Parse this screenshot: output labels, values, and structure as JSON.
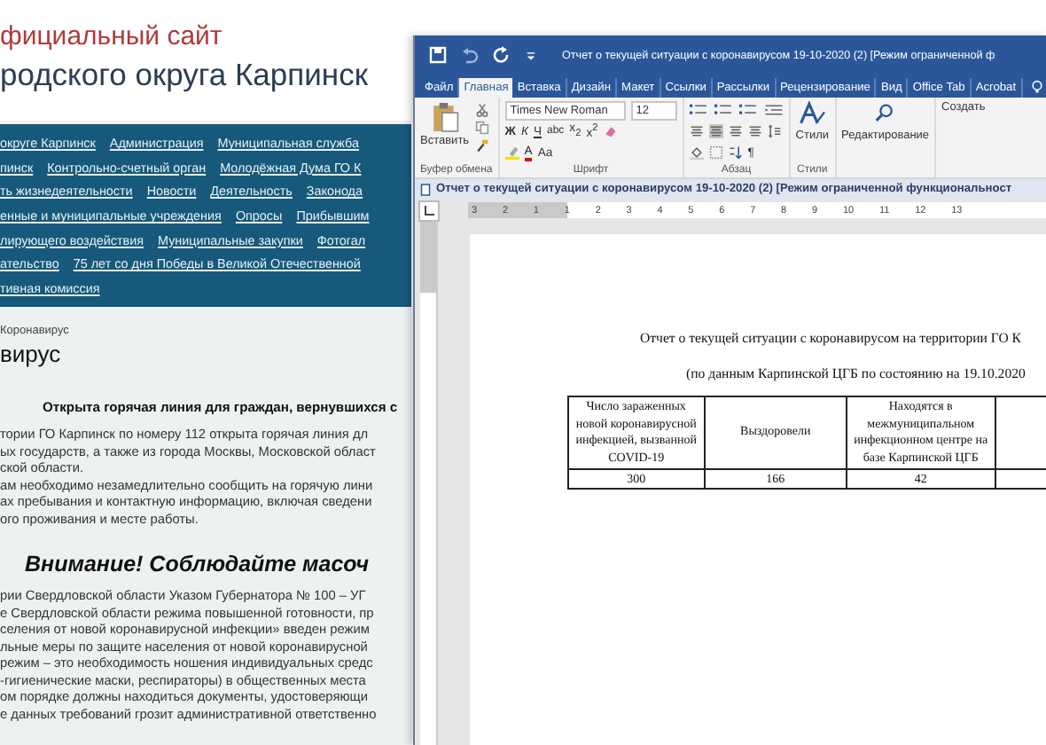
{
  "website": {
    "header_subtitle": "фициальный сайт",
    "header_title": "родского округа Карпинск",
    "nav_rows": [
      [
        "округе Карпинск",
        "Администрация",
        "Муниципальная служба"
      ],
      [
        "пинск",
        "Контрольно-счетный орган",
        "Молодёжная Дума ГО К"
      ],
      [
        "ть жизнедеятельности",
        "Новости",
        "Деятельность",
        "Законода"
      ],
      [
        "енные и муниципальные учреждения",
        "Опросы",
        "Прибывшим"
      ],
      [
        "лирующего воздействия",
        "Муниципальные закупки",
        "Фотогал"
      ],
      [
        "ательство",
        "75 лет со дня Победы в Великой Отечественной"
      ],
      [
        "тивная комиссия"
      ]
    ],
    "breadcrumb": "Коронавирус",
    "page_title": "вирус",
    "article": [
      {
        "kind": "heading",
        "text": "Открыта горячая линия для граждан, вернувшихся с"
      },
      {
        "kind": "paragraph",
        "lines": [
          "тории ГО Карпинск по номеру 112 открыта горячая линия дл",
          "ых государств, а также из города Москвы, Московской област",
          "ской области.",
          "ам необходимо незамедлительно сообщить на горячую лини",
          "ах пребывания и контактную информацию, включая сведени",
          "ого проживания и месте работы."
        ]
      },
      {
        "kind": "big_heading",
        "text": "Внимание! Соблюдайте масоч"
      },
      {
        "kind": "paragraph",
        "lines": [
          "рии Свердловской области Указом Губернатора № 100 – УГ",
          "е Свердловской области режима повышенной готовности, пр",
          "селения от новой коронавирусной инфекции» введен режим",
          "льные меры по защите населения от новой коронавирусной",
          "режим – это необходимость ношения индивидуальных средс",
          "-гигиенические маски, респираторы) в общественных места",
          "ом порядке должны находиться документы, удостоверяющи",
          "е данных требований грозит административной ответственно"
        ]
      }
    ]
  },
  "word": {
    "title": "Отчет о текущей ситуации с коронавирусом 19-10-2020 (2) [Режим ограниченной ф",
    "tabs": [
      {
        "label": "Файл",
        "selected": false
      },
      {
        "label": "Главная",
        "selected": true
      },
      {
        "label": "Вставка",
        "selected": false
      },
      {
        "label": "Дизайн",
        "selected": false
      },
      {
        "label": "Макет",
        "selected": false
      },
      {
        "label": "Ссылки",
        "selected": false
      },
      {
        "label": "Рассылки",
        "selected": false
      },
      {
        "label": "Рецензирование",
        "selected": false
      },
      {
        "label": "Вид",
        "selected": false
      },
      {
        "label": "Office Tab",
        "selected": false
      },
      {
        "label": "Acrobat",
        "selected": false
      }
    ],
    "ribbon": {
      "paste_label": "Вставить",
      "font_name": "Times New Roman",
      "font_size": "12",
      "format_buttons": [
        "Ж",
        "К",
        "Ч",
        "abc",
        "x$_{2}$",
        "x$^{2}$"
      ],
      "font_color_button": "A",
      "case_button": "Aa",
      "pilcrow_button": "¶",
      "styles_label": "Стили",
      "editing_label": "Редактирование",
      "create_label": "Создать",
      "group_labels": [
        "Буфер обмена",
        "Шрифт",
        "Абзац",
        "Стили"
      ]
    },
    "document_tab": "Отчет о текущей ситуации с коронавирусом 19-10-2020 (2) [Режим ограниченной функциональност",
    "ruler_labels": [
      "3",
      "2",
      "1",
      "1",
      "2",
      "3",
      "4",
      "5",
      "6",
      "7",
      "8",
      "9",
      "10",
      "11",
      "12",
      "13"
    ],
    "document": {
      "title": "Отчет о текущей ситуации с коронавирусом на территории ГО К",
      "subtitle": "(по данным Карпинской ЦГБ по состоянию на 19.10.2020",
      "table": {
        "columns": [
          "Число зараженных новой коронавирусной инфекцией, вызванной COVID-19",
          "Выздоровели",
          "Находятся в межмуниципальном инфекционном центре на базе Карпинской ЦГБ"
        ],
        "rows": [
          [
            "300",
            "166",
            "42"
          ]
        ]
      }
    }
  }
}
